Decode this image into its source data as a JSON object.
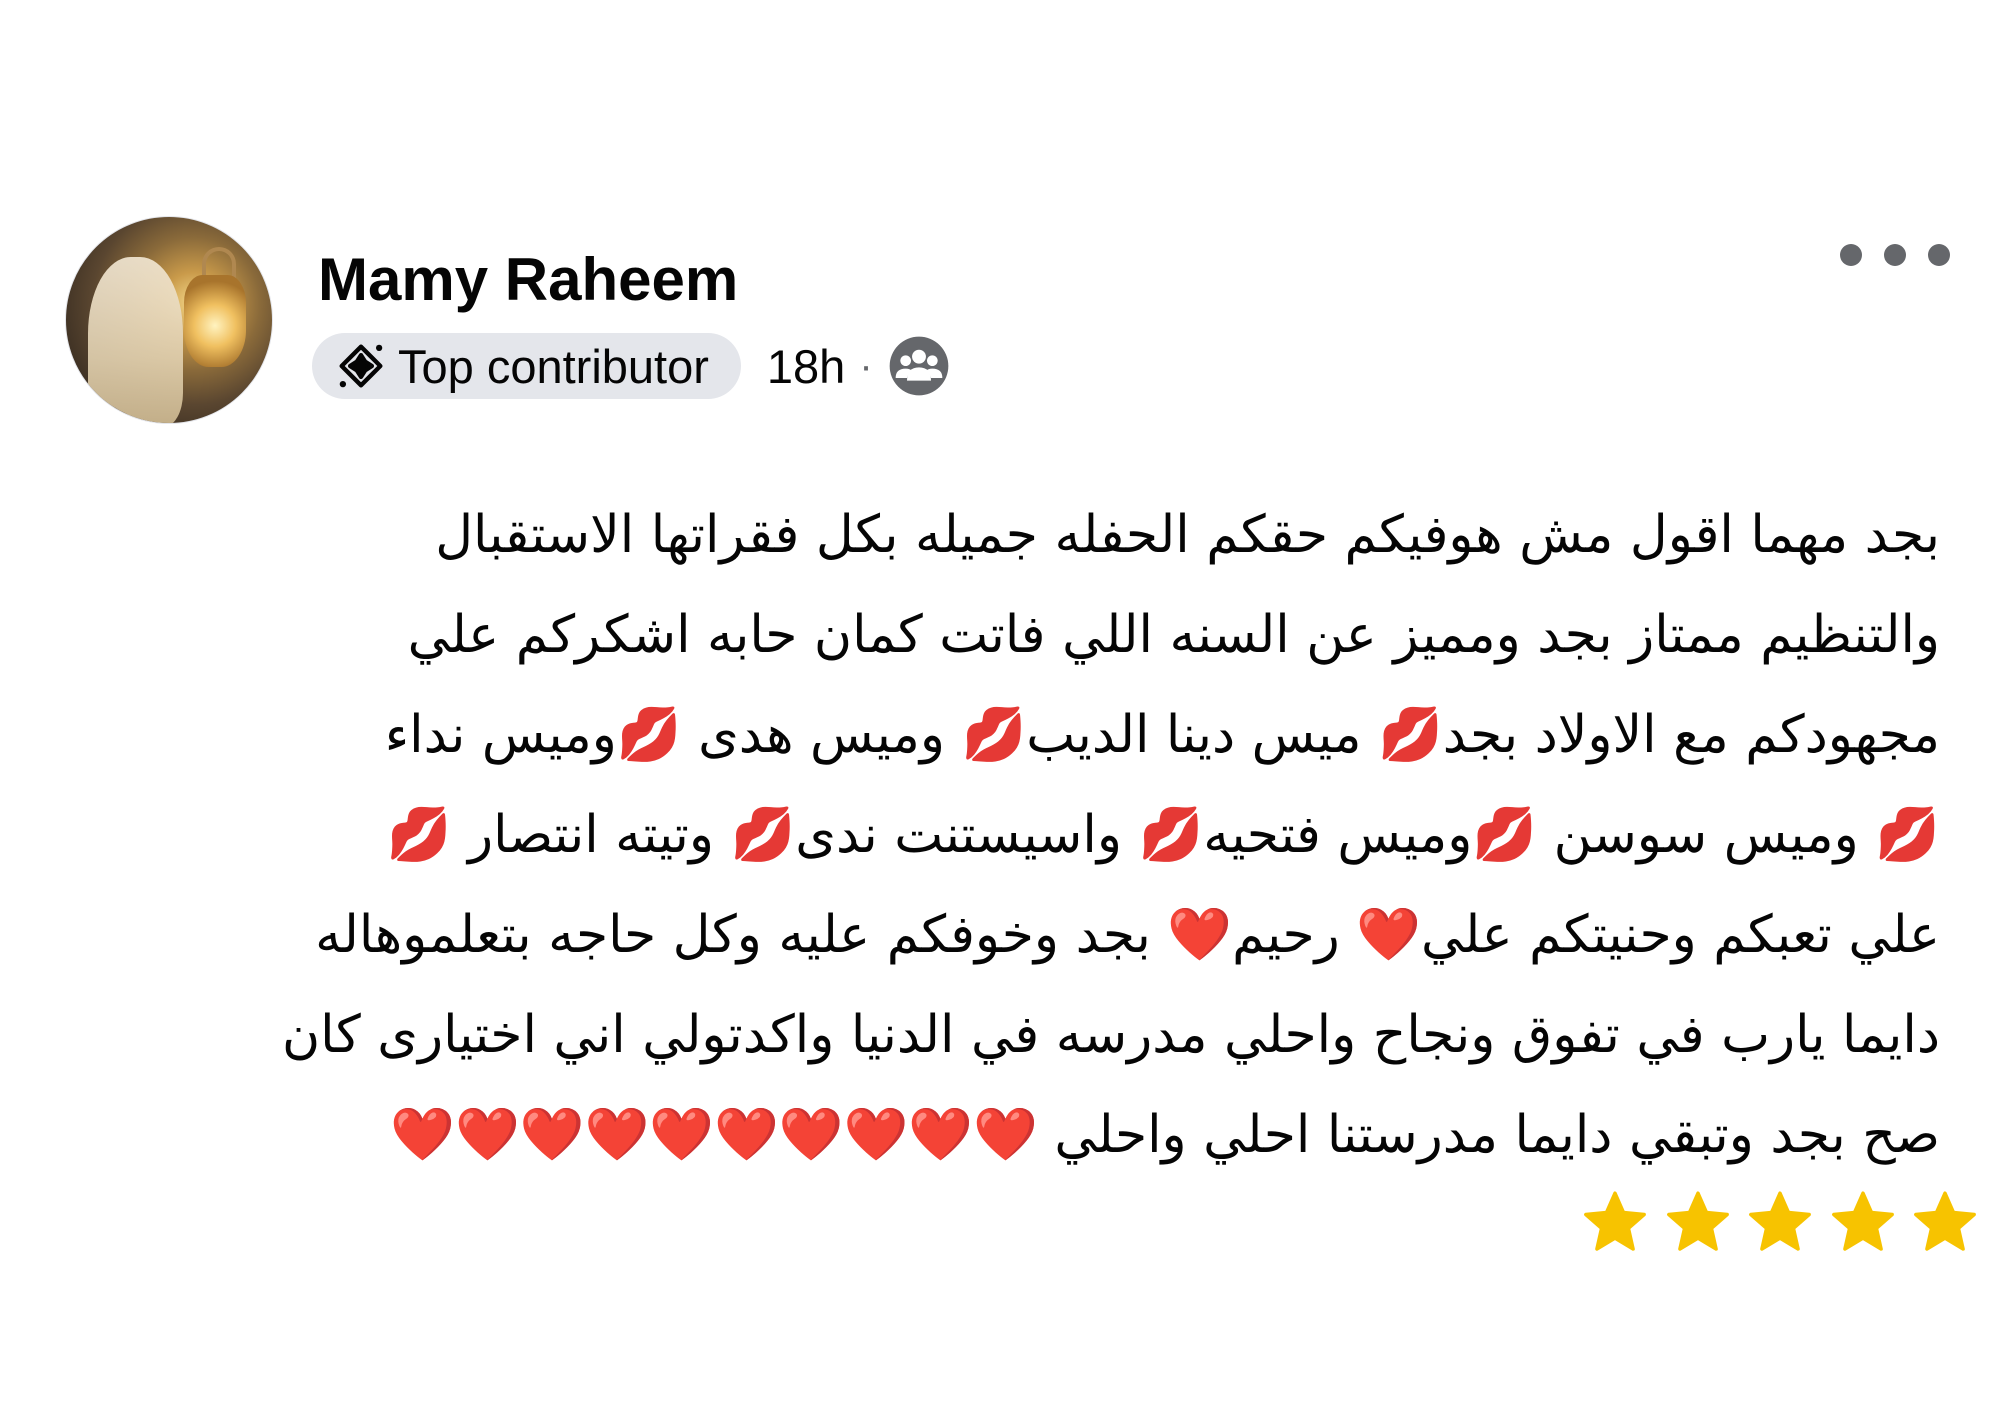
{
  "post": {
    "author": {
      "name": "Mamy Raheem",
      "avatar_icon": "profile-photo"
    },
    "badge": {
      "label": "Top contributor",
      "icon": "top-contributor-icon"
    },
    "time": "18h",
    "separator": "·",
    "audience_icon": "group-members-icon",
    "more_icon": "more-options-icon",
    "body_lines": [
      "بجد مهما اقول مش هوفيكم حقكم الحفله جميله بكل فقراتها الاستقبال",
      "والتنظيم ممتاز بجد ومميز عن السنه اللي فاتت كمان حابه اشكركم علي",
      "مجهودكم مع الاولاد بجد💋 ميس دينا الديب💋 وميس هدى 💋وميس نداء",
      "💋 وميس سوسن 💋وميس فتحيه💋 واسيستنت ندى💋 وتيته انتصار 💋",
      "علي تعبكم وحنيتكم علي❤️ رحيم❤️ بجد وخوفكم عليه وكل حاجه بتعلموهاله",
      "دايما يارب في تفوق ونجاح واحلي مدرسه في الدنيا واكدتولي اني اختيارى كان",
      "صح بجد وتبقي دايما مدرستنا احلي واحلي ❤️❤️❤️❤️❤️❤️❤️❤️❤️❤️"
    ],
    "rating": {
      "stars": 5,
      "max": 5,
      "color": "#f7c300"
    },
    "colors": {
      "text": "#050505",
      "secondary": "#65676b",
      "badge_bg": "#e4e6eb"
    }
  }
}
